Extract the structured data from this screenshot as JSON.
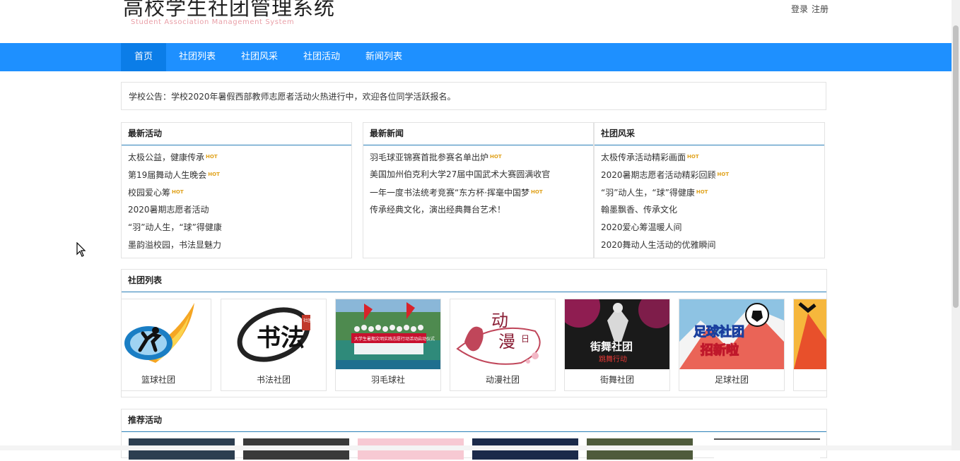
{
  "header": {
    "title": "高校学生社团管理系统",
    "subtitle": "Student Association Management System",
    "login": "登录",
    "register": "注册"
  },
  "nav": {
    "items": [
      "首页",
      "社团列表",
      "社团风采",
      "社团活动",
      "新闻列表"
    ],
    "active": 0
  },
  "notice": "学校公告：学校2020年暑假西部教师志愿者活动火热进行中，欢迎各位同学活跃报名。",
  "hot_label": "HOT",
  "latest_activities": {
    "title": "最新活动",
    "items": [
      {
        "text": "太极公益，健康传承",
        "hot": true
      },
      {
        "text": "第19届舞动人生晚会",
        "hot": true
      },
      {
        "text": "校园爱心筹",
        "hot": true
      },
      {
        "text": "2020暑期志愿者活动",
        "hot": false
      },
      {
        "text": "“羽”动人生，“球”得健康",
        "hot": false
      },
      {
        "text": "墨韵溢校园，书法显魅力",
        "hot": false
      }
    ]
  },
  "latest_news": {
    "title": "最新新闻",
    "items": [
      {
        "text": "羽毛球亚锦赛首批参赛名单出炉",
        "hot": true
      },
      {
        "text": "美国加州伯克利大学27届中国武术大赛圆满收官",
        "hot": false
      },
      {
        "text": "一年一度书法统考竞赛“东方杯·挥毫中国梦",
        "hot": true
      },
      {
        "text": "传承经典文化，演出经典舞台艺术！",
        "hot": false
      }
    ]
  },
  "club_style": {
    "title": "社团风采",
    "items": [
      {
        "text": "太极传承活动精彩画面",
        "hot": true
      },
      {
        "text": "2020暑期志愿者活动精彩回顾",
        "hot": true
      },
      {
        "text": "“羽”动人生，“球”得健康",
        "hot": true
      },
      {
        "text": "翰墨飘香、传承文化",
        "hot": false
      },
      {
        "text": "2020爱心筹温暖人间",
        "hot": false
      },
      {
        "text": "2020舞动人生活动的优雅瞬间",
        "hot": false
      }
    ]
  },
  "club_list": {
    "title": "社团列表",
    "clubs": [
      "篮球社团",
      "书法社团",
      "羽毛球社",
      "动漫社团",
      "街舞社团",
      "足球社团",
      ""
    ],
    "image_text": {
      "calligraphy": "书法",
      "calligraphy_seal": "社团",
      "badminton_banner": "大学生暑期文明实践志愿行动活动启动仪式",
      "anime": [
        "动",
        "漫",
        "日"
      ],
      "dance": "街舞社团",
      "dance_sub": "跳舞行动",
      "football": "足球社团",
      "football_sub": "招新啦"
    }
  },
  "recommended": {
    "title": "推荐活动"
  },
  "colors": {
    "primary": "#1e90ff",
    "active_nav": "#0b7de8",
    "hot": "#e0a21b",
    "panel_rule": "#2a7fb8"
  }
}
